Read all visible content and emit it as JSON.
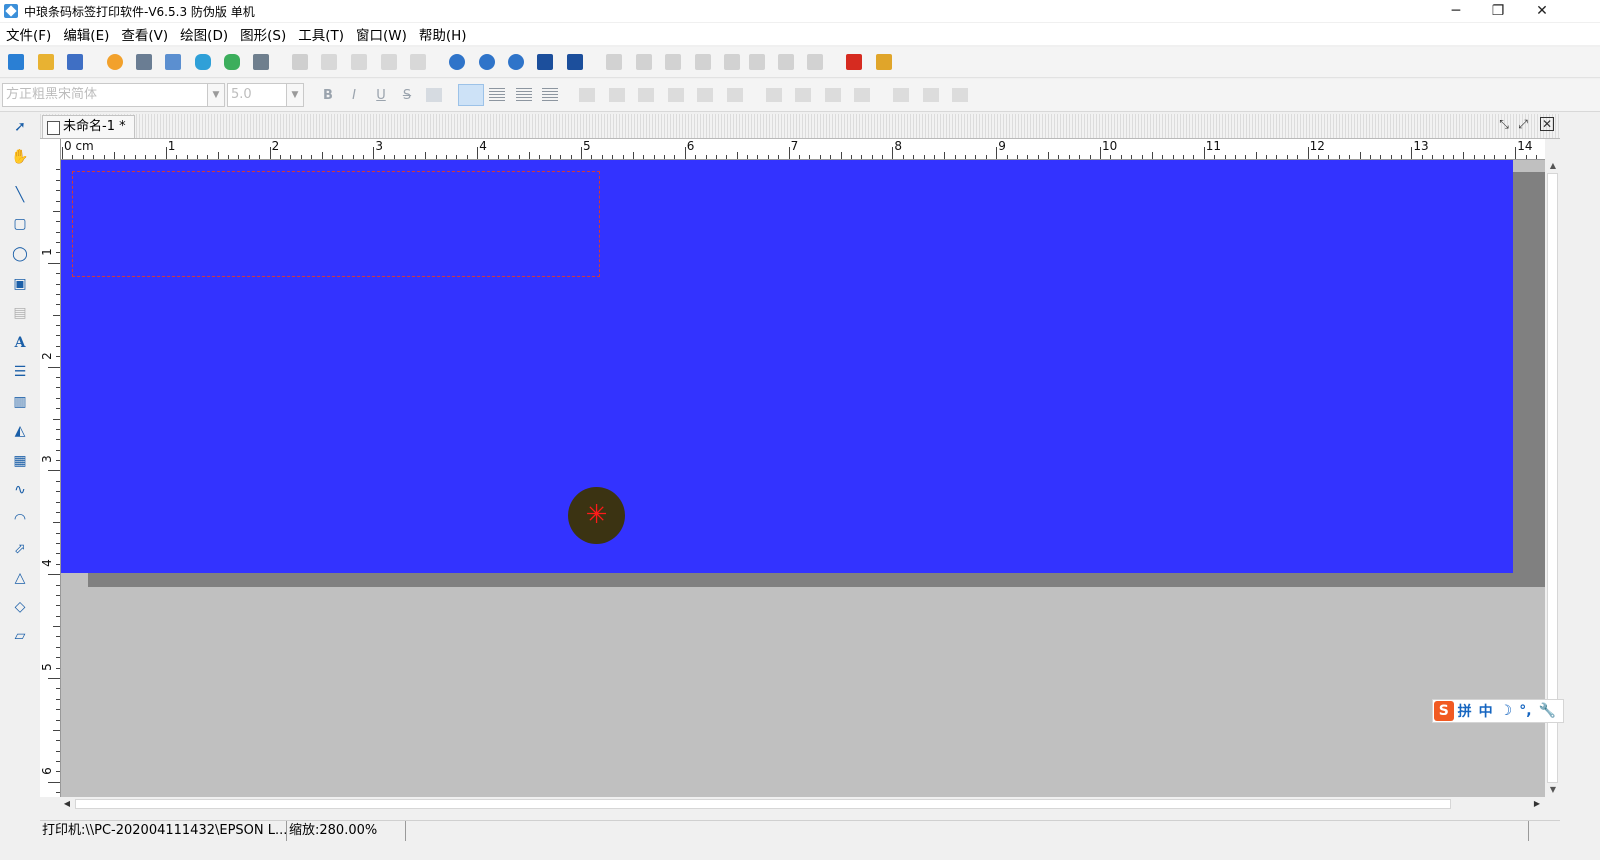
{
  "window": {
    "title": "中琅条码标签打印软件-V6.5.3 防伪版 单机",
    "minimize": "─",
    "restore": "❐",
    "close": "✕"
  },
  "menu": [
    {
      "label": "文件(F)"
    },
    {
      "label": "编辑(E)"
    },
    {
      "label": "查看(V)"
    },
    {
      "label": "绘图(D)"
    },
    {
      "label": "图形(S)"
    },
    {
      "label": "工具(T)"
    },
    {
      "label": "窗口(W)"
    },
    {
      "label": "帮助(H)"
    }
  ],
  "format_bar": {
    "font_name": "方正粗黑宋简体",
    "font_size": "5.0",
    "bold": "B",
    "italic": "I",
    "underline": "U",
    "strikethrough": "S"
  },
  "document": {
    "tab_title": "未命名-1 *"
  },
  "ruler": {
    "unit": "cm",
    "h_labels": [
      "0",
      "1",
      "2",
      "3",
      "4",
      "5",
      "6",
      "7",
      "8",
      "9",
      "10",
      "11",
      "12",
      "13",
      "14"
    ],
    "v_labels": [
      "1",
      "2",
      "3",
      "4",
      "5",
      "6"
    ]
  },
  "status": {
    "printer": "打印机:\\\\PC-202004111432\\EPSON L...",
    "zoom": "缩放:280.00%"
  },
  "ime": {
    "logo": "S",
    "mode": "拼",
    "lang": "中",
    "moon": "☽",
    "punct": "°,",
    "tool": "🔧"
  },
  "colors": {
    "canvas": "#3333ff",
    "workspace": "#c0c0c0"
  }
}
